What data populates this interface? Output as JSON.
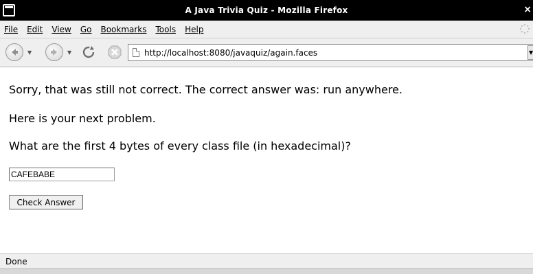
{
  "window": {
    "title": "A Java Trivia Quiz - Mozilla Firefox",
    "close_glyph": "×"
  },
  "menubar": {
    "items": [
      {
        "label": "File"
      },
      {
        "label": "Edit"
      },
      {
        "label": "View"
      },
      {
        "label": "Go"
      },
      {
        "label": "Bookmarks"
      },
      {
        "label": "Tools"
      },
      {
        "label": "Help"
      }
    ]
  },
  "navbar": {
    "url": "http://localhost:8080/javaquiz/again.faces",
    "icons": [
      "back-icon",
      "forward-icon",
      "reload-icon",
      "stop-icon",
      "page-icon"
    ]
  },
  "page": {
    "feedback": "Sorry, that was still not correct. The correct answer was: run anywhere.",
    "next_problem": "Here is your next problem.",
    "question": "What are the first 4 bytes of every class file (in hexadecimal)?",
    "answer_value": "CAFEBABE",
    "check_button": "Check Answer"
  },
  "status": {
    "text": "Done"
  },
  "colors": {
    "titlebar_bg": "#000000",
    "chrome_bg": "#efefef",
    "content_bg": "#ffffff"
  }
}
